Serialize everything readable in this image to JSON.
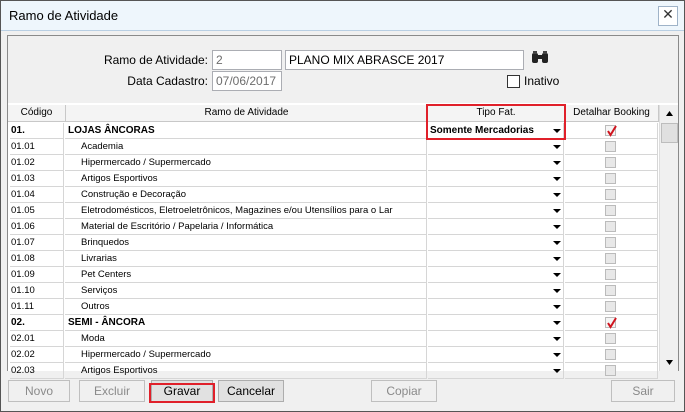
{
  "window": {
    "title": "Ramo de Atividade",
    "close_glyph": "✕"
  },
  "form": {
    "ramo_label": "Ramo de Atividade:",
    "ramo_code": "2",
    "ramo_name": "PLANO MIX ABRASCE 2017",
    "data_label": "Data Cadastro:",
    "data_value": "07/06/2017",
    "inativo_label": "Inativo"
  },
  "grid": {
    "headers": [
      "Código",
      "Ramo de Atividade",
      "Tipo Fat.",
      "Detalhar Booking"
    ],
    "rows": [
      {
        "code": "01.",
        "name": "LOJAS ÂNCORAS",
        "tipo": "Somente Mercadorias",
        "group": true,
        "checked": true
      },
      {
        "code": "01.01",
        "name": "Academia",
        "tipo": "",
        "group": false,
        "checked": false
      },
      {
        "code": "01.02",
        "name": "Hipermercado / Supermercado",
        "tipo": "",
        "group": false,
        "checked": false
      },
      {
        "code": "01.03",
        "name": "Artigos Esportivos",
        "tipo": "",
        "group": false,
        "checked": false
      },
      {
        "code": "01.04",
        "name": "Construção e Decoração",
        "tipo": "",
        "group": false,
        "checked": false
      },
      {
        "code": "01.05",
        "name": "Eletrodomésticos, Eletroeletrônicos, Magazines e/ou Utensílios para o Lar",
        "tipo": "",
        "group": false,
        "checked": false
      },
      {
        "code": "01.06",
        "name": "Material de Escritório / Papelaria / Informática",
        "tipo": "",
        "group": false,
        "checked": false
      },
      {
        "code": "01.07",
        "name": "Brinquedos",
        "tipo": "",
        "group": false,
        "checked": false
      },
      {
        "code": "01.08",
        "name": "Livrarias",
        "tipo": "",
        "group": false,
        "checked": false
      },
      {
        "code": "01.09",
        "name": "Pet Centers",
        "tipo": "",
        "group": false,
        "checked": false
      },
      {
        "code": "01.10",
        "name": "Serviços",
        "tipo": "",
        "group": false,
        "checked": false
      },
      {
        "code": "01.11",
        "name": "Outros",
        "tipo": "",
        "group": false,
        "checked": false
      },
      {
        "code": "02.",
        "name": "SEMI - ÂNCORA",
        "tipo": "",
        "group": true,
        "checked": true
      },
      {
        "code": "02.01",
        "name": "Moda",
        "tipo": "",
        "group": false,
        "checked": false
      },
      {
        "code": "02.02",
        "name": "Hipermercado / Supermercado",
        "tipo": "",
        "group": false,
        "checked": false
      },
      {
        "code": "02.03",
        "name": "Artigos Esportivos",
        "tipo": "",
        "group": false,
        "checked": false
      }
    ]
  },
  "buttons": {
    "novo": "Novo",
    "excluir": "Excluir",
    "gravar": "Gravar",
    "cancelar": "Cancelar",
    "copiar": "Copiar",
    "sair": "Sair"
  },
  "colors": {
    "highlight": "#e0202a",
    "check_red": "#d0151f"
  }
}
